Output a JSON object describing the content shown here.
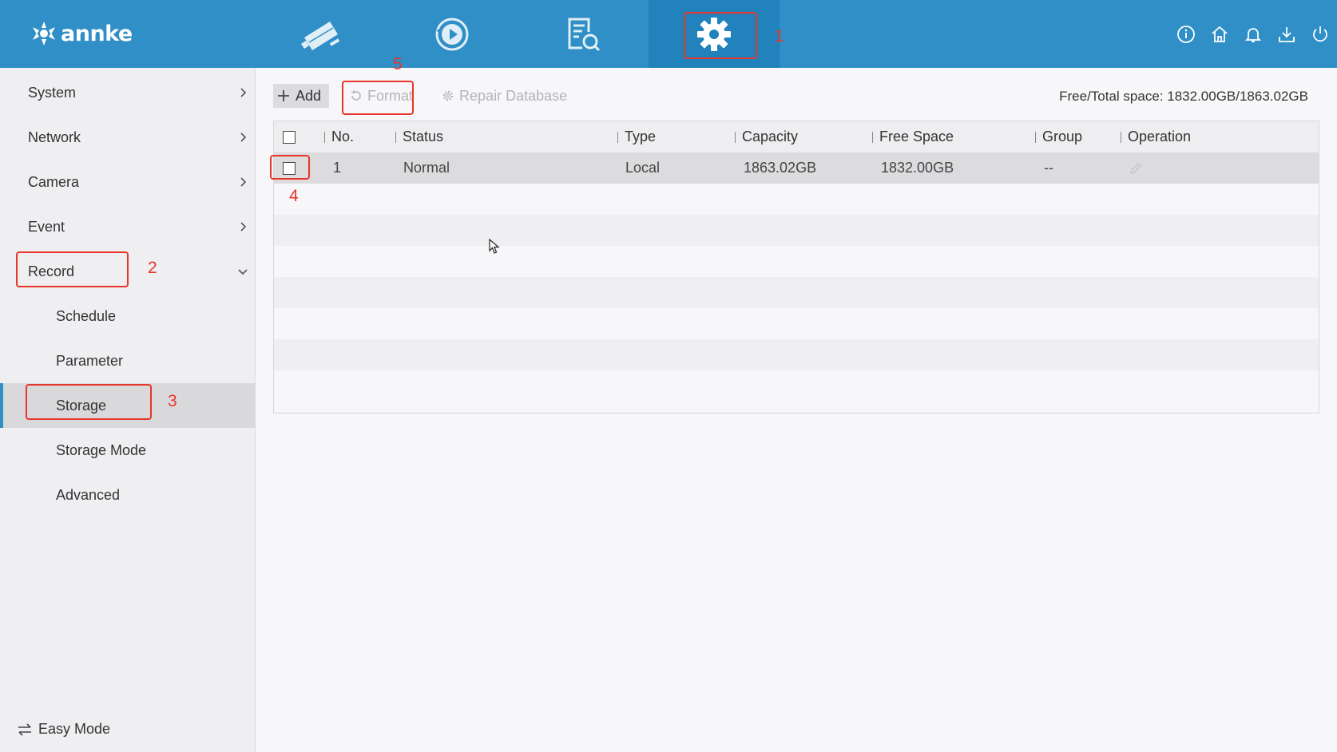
{
  "brand": {
    "logo_text": "annke"
  },
  "topnav": {
    "items": [
      {
        "name": "live-view",
        "icon": "camera-icon"
      },
      {
        "name": "playback",
        "icon": "playback-icon"
      },
      {
        "name": "search",
        "icon": "file-search-icon"
      },
      {
        "name": "configuration",
        "icon": "gear-icon",
        "active": true
      }
    ],
    "right_icons": [
      "info-icon",
      "home-icon",
      "bell-icon",
      "download-icon",
      "power-icon"
    ]
  },
  "sidebar": {
    "items": [
      {
        "label": "System"
      },
      {
        "label": "Network"
      },
      {
        "label": "Camera"
      },
      {
        "label": "Event"
      },
      {
        "label": "Record",
        "expanded": true
      },
      {
        "label": "Schedule"
      },
      {
        "label": "Parameter"
      },
      {
        "label": "Storage",
        "selected": true
      },
      {
        "label": "Storage Mode"
      },
      {
        "label": "Advanced"
      }
    ],
    "easy_mode": "Easy Mode"
  },
  "toolbar": {
    "add": "Add",
    "format": "Format",
    "repair": "Repair Database",
    "space_info": "Free/Total space: 1832.00GB/1863.02GB"
  },
  "table": {
    "headers": [
      "No.",
      "Status",
      "Type",
      "Capacity",
      "Free Space",
      "Group",
      "Operation"
    ],
    "rows": [
      {
        "no": "1",
        "status": "Normal",
        "type": "Local",
        "capacity": "1863.02GB",
        "free": "1832.00GB",
        "group": "--"
      }
    ]
  },
  "annotations": [
    "1",
    "2",
    "3",
    "4",
    "5"
  ],
  "colors": {
    "header_blue": "#2f8fc6",
    "annotation_red": "#e8352b"
  }
}
